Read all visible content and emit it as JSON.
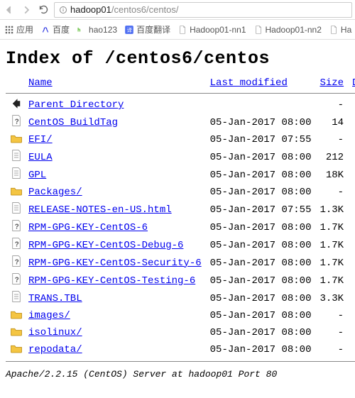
{
  "browser": {
    "url_host": "hadoop01",
    "url_path": "/centos6/centos/",
    "bookmarks": [
      {
        "label": "应用",
        "icon": "apps"
      },
      {
        "label": "百度",
        "icon": "baidu"
      },
      {
        "label": "hao123",
        "icon": "hao123"
      },
      {
        "label": "百度翻译",
        "icon": "fanyi"
      },
      {
        "label": "Hadoop01-nn1",
        "icon": "doc"
      },
      {
        "label": "Hadoop01-nn2",
        "icon": "doc"
      },
      {
        "label": "Ha",
        "icon": "doc"
      }
    ]
  },
  "page": {
    "heading": "Index of /centos6/centos",
    "columns": {
      "name": "Name",
      "modified": "Last modified",
      "size": "Size",
      "desc": "Description"
    },
    "rows": [
      {
        "icon": "back",
        "name": "Parent Directory",
        "date": "",
        "size": "-"
      },
      {
        "icon": "unknown",
        "name": "CentOS_BuildTag",
        "date": "05-Jan-2017 08:00",
        "size": "14"
      },
      {
        "icon": "folder",
        "name": "EFI/",
        "date": "05-Jan-2017 07:55",
        "size": "-"
      },
      {
        "icon": "text",
        "name": "EULA",
        "date": "05-Jan-2017 08:00",
        "size": "212"
      },
      {
        "icon": "text",
        "name": "GPL",
        "date": "05-Jan-2017 08:00",
        "size": "18K"
      },
      {
        "icon": "folder",
        "name": "Packages/",
        "date": "05-Jan-2017 08:00",
        "size": "-"
      },
      {
        "icon": "text",
        "name": "RELEASE-NOTES-en-US.html",
        "date": "05-Jan-2017 07:55",
        "size": "1.3K"
      },
      {
        "icon": "unknown",
        "name": "RPM-GPG-KEY-CentOS-6",
        "date": "05-Jan-2017 08:00",
        "size": "1.7K"
      },
      {
        "icon": "unknown",
        "name": "RPM-GPG-KEY-CentOS-Debug-6",
        "date": "05-Jan-2017 08:00",
        "size": "1.7K"
      },
      {
        "icon": "unknown",
        "name": "RPM-GPG-KEY-CentOS-Security-6",
        "date": "05-Jan-2017 08:00",
        "size": "1.7K"
      },
      {
        "icon": "unknown",
        "name": "RPM-GPG-KEY-CentOS-Testing-6",
        "date": "05-Jan-2017 08:00",
        "size": "1.7K"
      },
      {
        "icon": "text",
        "name": "TRANS.TBL",
        "date": "05-Jan-2017 08:00",
        "size": "3.3K"
      },
      {
        "icon": "folder",
        "name": "images/",
        "date": "05-Jan-2017 08:00",
        "size": "-"
      },
      {
        "icon": "folder",
        "name": "isolinux/",
        "date": "05-Jan-2017 08:00",
        "size": "-"
      },
      {
        "icon": "folder",
        "name": "repodata/",
        "date": "05-Jan-2017 08:00",
        "size": "-"
      }
    ],
    "footer": "Apache/2.2.15 (CentOS) Server at hadoop01 Port 80"
  }
}
